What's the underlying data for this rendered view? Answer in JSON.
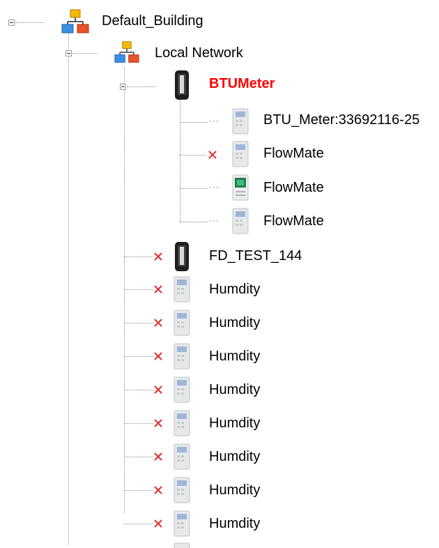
{
  "tree": {
    "root": {
      "label": "Default_Building",
      "icon": "network-icon",
      "expanded": true
    },
    "network": {
      "label": "Local Network",
      "icon": "network-icon",
      "expanded": true
    },
    "bt_meter": {
      "label": "BTUMeter",
      "icon": "meter-device-icon",
      "expanded": true,
      "status": "alarm",
      "color": "#ff0000",
      "children": [
        {
          "label": "BTU_Meter:33692116-25",
          "icon": "sensor-device-icon",
          "status": "ok"
        },
        {
          "label": "FlowMate",
          "icon": "sensor-device-icon",
          "status": "offline"
        },
        {
          "label": "FlowMate",
          "icon": "display-device-icon",
          "status": "ok"
        },
        {
          "label": "FlowMate",
          "icon": "sensor-device-icon",
          "status": "ok"
        }
      ]
    },
    "devices": [
      {
        "label": "FD_TEST_144",
        "icon": "meter-device-icon",
        "status": "offline"
      },
      {
        "label": "Humdity",
        "icon": "sensor-device-icon",
        "status": "offline"
      },
      {
        "label": "Humdity",
        "icon": "sensor-device-icon",
        "status": "offline"
      },
      {
        "label": "Humdity",
        "icon": "sensor-device-icon",
        "status": "offline"
      },
      {
        "label": "Humdity",
        "icon": "sensor-device-icon",
        "status": "offline"
      },
      {
        "label": "Humdity",
        "icon": "sensor-device-icon",
        "status": "offline"
      },
      {
        "label": "Humdity",
        "icon": "sensor-device-icon",
        "status": "offline"
      },
      {
        "label": "Humdity",
        "icon": "sensor-device-icon",
        "status": "offline"
      },
      {
        "label": "Humdity",
        "icon": "sensor-device-icon",
        "status": "offline"
      }
    ],
    "status_colors": {
      "offline": "#e03030",
      "alarm": "#ff0000"
    }
  }
}
